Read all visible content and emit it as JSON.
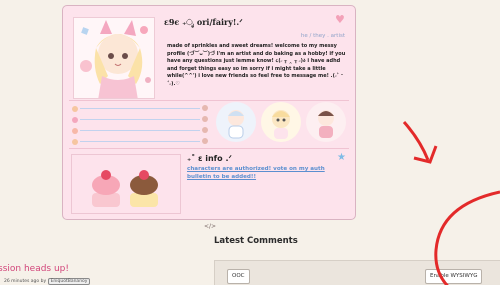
{
  "profile": {
    "name": "ε9ϵ ₊ೃ ori/fairy!.ᐟ",
    "pronouns": "he / they . artist",
    "bio": "made of sprinkles and sweet dreams! welcome to my messy profile (づ︶ᴗ︶)づ I'm an artist and do baking as a hobby! if you have any questions just lemme know! ૮(˶ ╥ ‸ ╥ ˶)ა i have adhd and forget things easy so im sorry if i might take a little while(^^') i love new friends so feel free to message me! .(˶˃ ᵕ ˂˶).♡",
    "info_title": "₊˚ ε info .ᐟ",
    "info_link": "characters are authorized! vote on my auth bulletin to be added!!",
    "code_icon": "</>"
  },
  "colors": {
    "accent_pink": "#d2467a",
    "link_blue": "#5b8fd0",
    "card_pink": "#fde3ec"
  },
  "comments": {
    "title": "Latest Comments",
    "ooc_label": "OOC",
    "wysiwyg_label": "Enable WYSIWYG"
  },
  "bulletin": {
    "title": "ssion heads up!",
    "time": "26 minutes ago by",
    "user": "EniquotBananoy"
  },
  "icons": {
    "heart": "heart-icon",
    "star": "star-icon",
    "code": "code-icon"
  }
}
